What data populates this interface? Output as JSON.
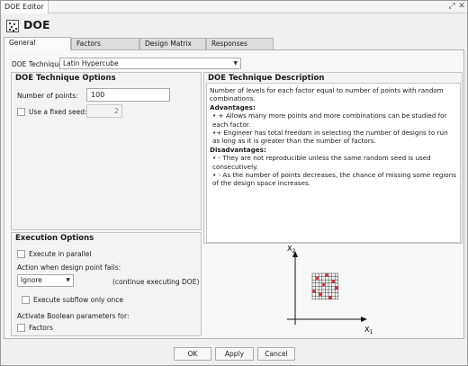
{
  "window": {
    "tab_title": "DOE Editor",
    "restore_glyph": "⤢",
    "close_glyph": "✕"
  },
  "header": {
    "title": "DOE",
    "icon": "doe-grid-icon"
  },
  "tabs": [
    "General",
    "Factors",
    "Design Matrix",
    "Responses"
  ],
  "technique": {
    "label": "DOE Technique:",
    "value": "Latin Hypercube"
  },
  "technique_options": {
    "title": "DOE Technique Options",
    "num_points_label": "Number of points:",
    "num_points_value": "100",
    "fixed_seed_label": "Use a fixed seed:",
    "fixed_seed_value": "2"
  },
  "description": {
    "title": "DOE Technique Description",
    "intro": "Number of levels for each factor equal to number of points with random combinations.",
    "advantages_heading": "Advantages:",
    "advantages": [
      "• + Allows many more points and more combinations can be studied for each factor.",
      "•+ Engineer has total freedom in selecting the number of designs to run as long as it is greater than the number of factors."
    ],
    "disadvantages_heading": "Disadvantages:",
    "disadvantages": [
      "• - They are not reproducible unless the same random seed is used consecutively.",
      "• - As the number of points decreases, the chance of missing some regions of the design space increases."
    ]
  },
  "execution": {
    "title": "Execution Options",
    "parallel_label": "Execute in parallel",
    "fail_label": "Action when design point fails:",
    "fail_value": "Ignore",
    "fail_note": "(continue executing DOE)",
    "subflow_label": "Execute subflow only once",
    "boolean_label": "Activate Boolean parameters for:",
    "factors_label": "Factors"
  },
  "diagram": {
    "y_axis": "X",
    "y_sub": "2",
    "x_axis": "X",
    "x_sub": "1",
    "accent_color": "#e8202a"
  },
  "buttons": {
    "ok": "OK",
    "apply": "Apply",
    "cancel": "Cancel"
  }
}
